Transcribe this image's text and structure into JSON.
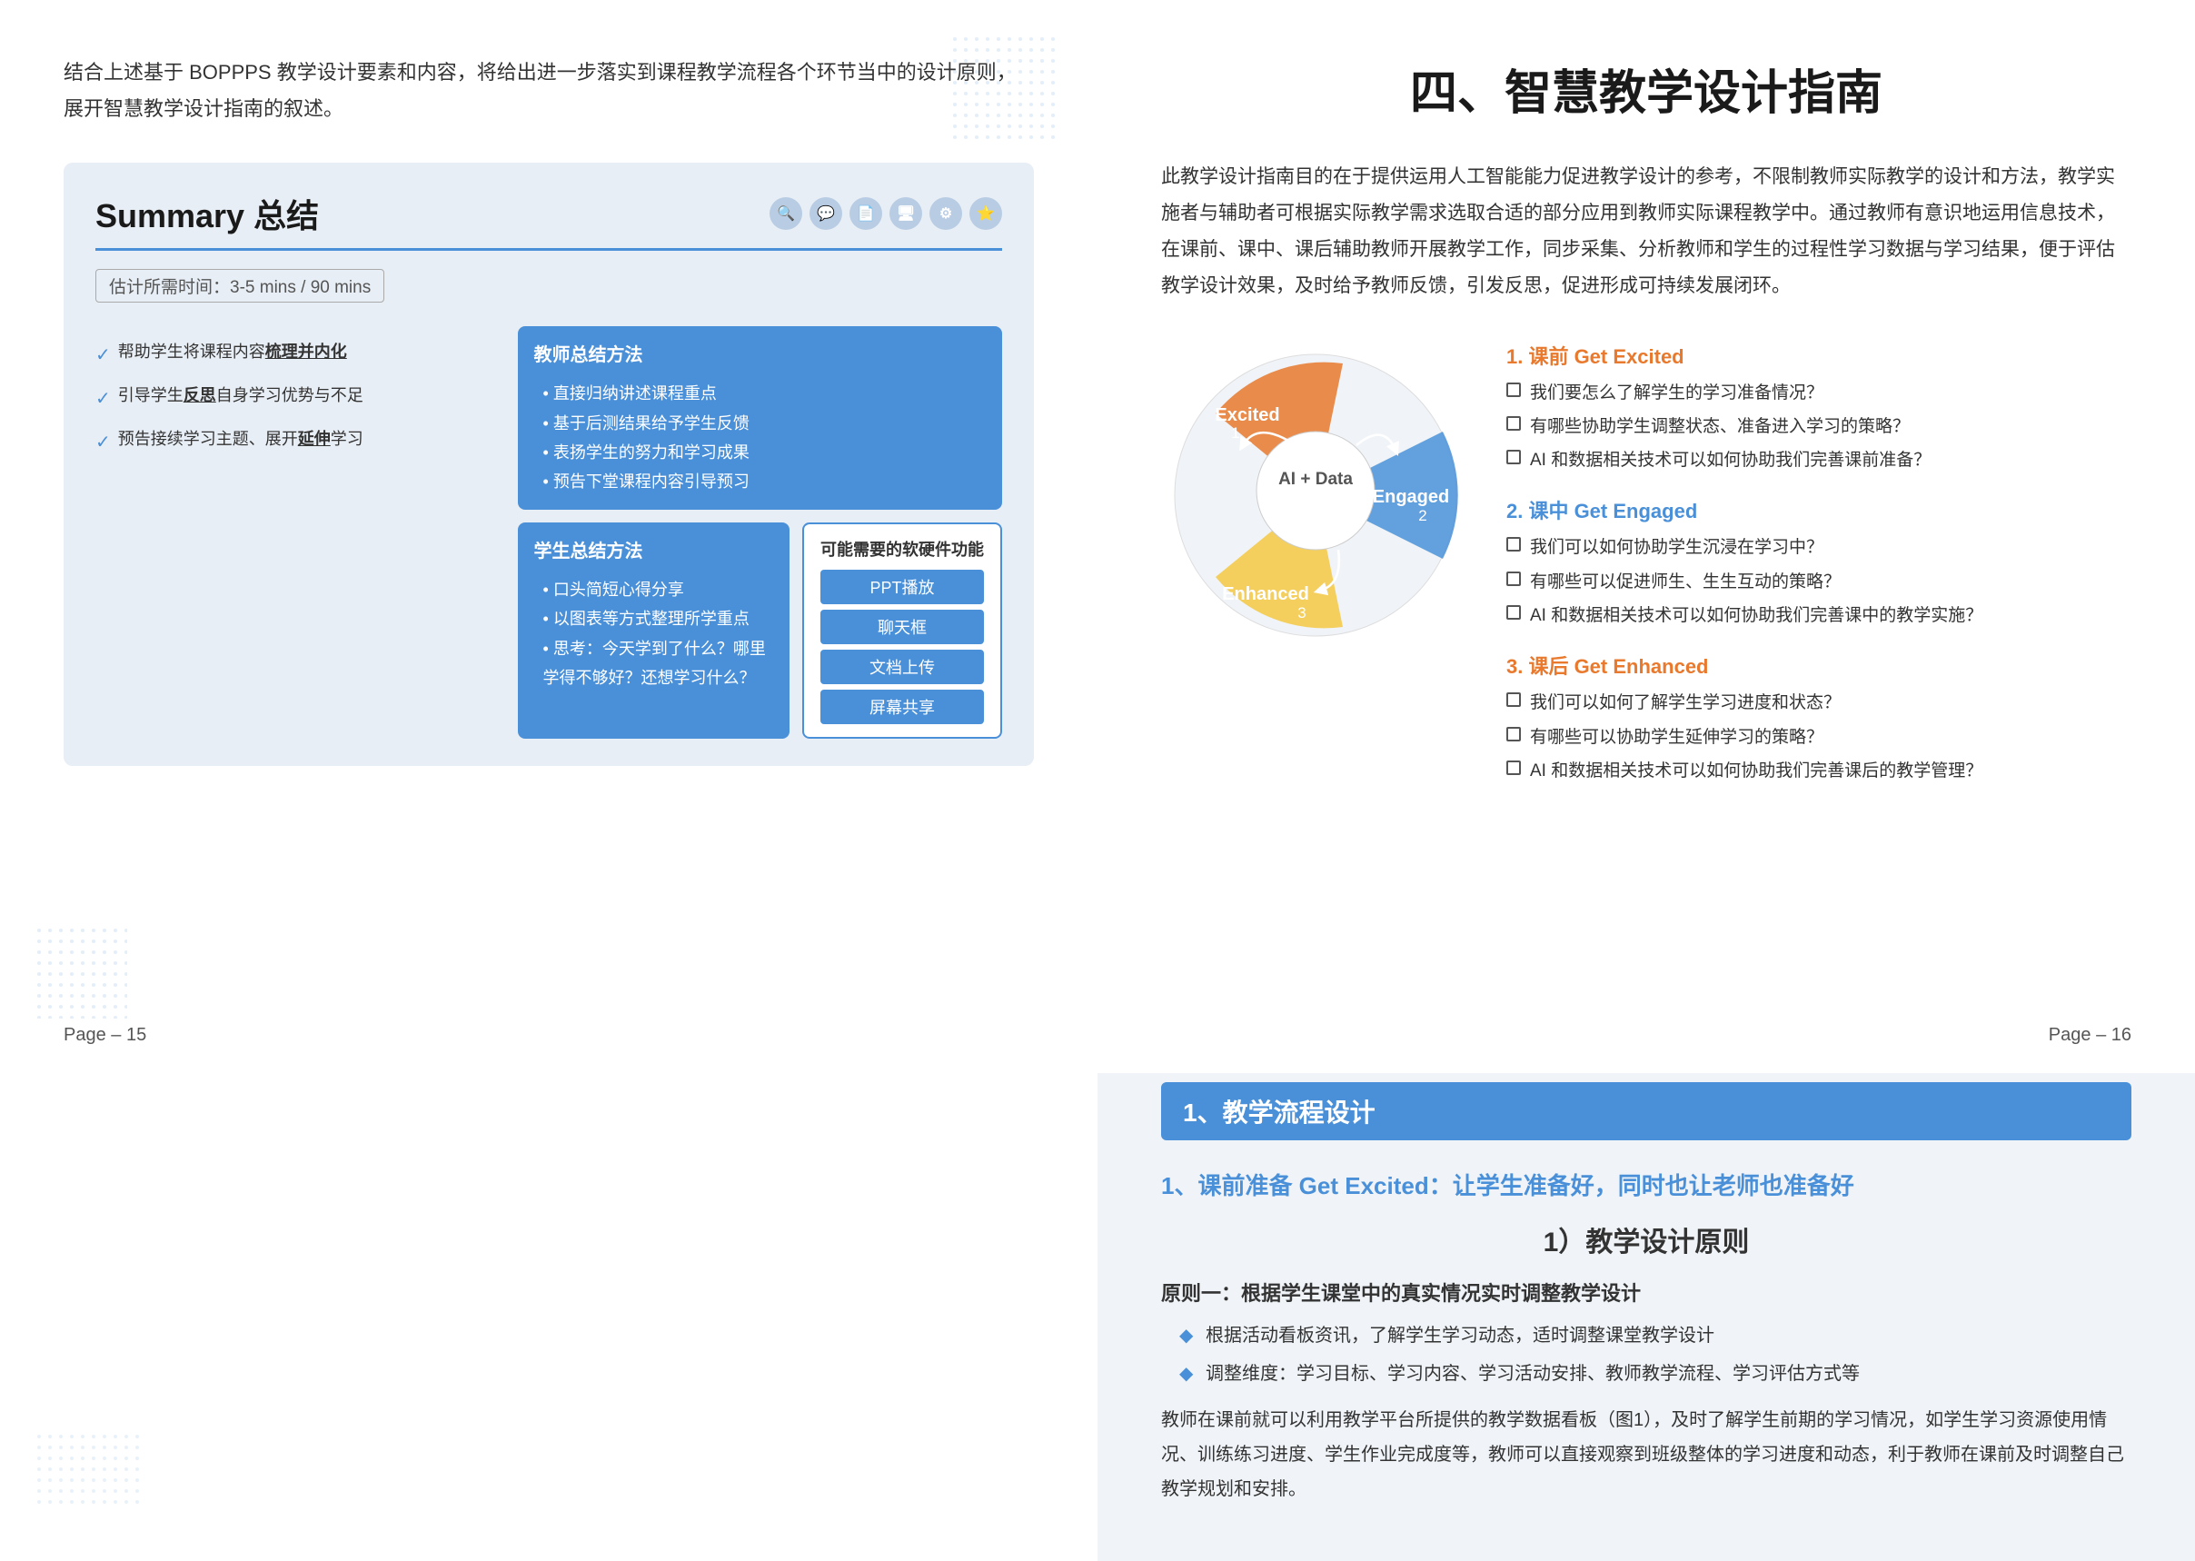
{
  "pageLeft": {
    "introText": "结合上述基于 BOPPPS 教学设计要素和内容，将给出进一步落实到课程教学流程各个环节当中的设计原则，展开智慧教学设计指南的叙述。",
    "summary": {
      "title": "Summary 总结",
      "timeLabel": "估计所需时间：3-5 mins / 90 mins",
      "teacherMethod": {
        "title": "教师总结方法",
        "items": [
          "直接归纳讲述课程重点",
          "基于后测结果给予学生反馈",
          "表扬学生的努力和学习成果",
          "预告下堂课程内容引导预习"
        ]
      },
      "software": {
        "title": "可能需要的软硬件功能",
        "items": [
          "PPT播放",
          "聊天框",
          "文档上传",
          "屏幕共享"
        ]
      },
      "studentMethod": {
        "title": "学生总结方法",
        "items": [
          "口头简短心得分享",
          "以图表等方式整理所学重点",
          "思考：今天学到了什么？哪里学得不够好？还想学习什么？"
        ]
      },
      "checklist": [
        "帮助学生将课程内容梳理并内化",
        "引导学生反思自身学习优势与不足",
        "预告接续学习主题、展开延伸学习"
      ]
    }
  },
  "pageRight": {
    "title": "四、智慧教学设计指南",
    "introText": "此教学设计指南目的在于提供运用人工智能能力促进教学设计的参考，不限制教师实际教学的设计和方法，教学实施者与辅助者可根据实际教学需求选取合适的部分应用到教师实际课程教学中。通过教师有意识地运用信息技术，在课前、课中、课后辅助教师开展教学工作，同步采集、分析教师和学生的过程性学习数据与学习结果，便于评估教学设计效果，及时给予教师反馈，引发反思，促进形成可持续发展闭环。",
    "diagram": {
      "labels": [
        "Excited",
        "Engaged",
        "Enhanced",
        "AI + Data"
      ],
      "colors": {
        "excited": "#e8792d",
        "engaged": "#4a90d9",
        "enhanced": "#f5c842",
        "aiData": "#888"
      }
    },
    "legend": {
      "section1": {
        "title": "1. 课前 Get Excited",
        "color": "orange",
        "items": [
          "我们要怎么了解学生的学习准备情况？",
          "有哪些协助学生调整状态、准备进入学习的策略？",
          "AI 和数据相关技术可以如何协助我们完善课前准备？"
        ]
      },
      "section2": {
        "title": "2. 课中 Get Engaged",
        "color": "blue",
        "items": [
          "我们可以如何协助学生沉浸在学习中？",
          "有哪些可以促进师生、生生互动的策略？",
          "AI 和数据相关技术可以如何协助我们完善课中的教学实施？"
        ]
      },
      "section3": {
        "title": "3. 课后 Get Enhanced",
        "color": "orange",
        "items": [
          "我们可以如何了解学生学习进度和状态？",
          "有哪些可以协助学生延伸学习的策略？",
          "AI 和数据相关技术可以如何协助我们完善课后的教学管理？"
        ]
      }
    }
  },
  "pageBottom": {
    "sectionHeader": "1、教学流程设计",
    "subsectionTitle": "1、课前准备 Get Excited：让学生准备好，同时也让老师也准备好",
    "centeredTitle": "1）教学设计原则",
    "principle1": {
      "title": "原则一：根据学生课堂中的真实情况实时调整教学设计",
      "points": [
        "根据活动看板资讯，了解学生学习动态，适时调整课堂教学设计",
        "调整维度：学习目标、学习内容、学习活动安排、教师教学流程、学习评估方式等"
      ],
      "bodyText": "教师在课前就可以利用教学平台所提供的教学数据看板（图1），及时了解学生前期的学习情况，如学生学习资源使用情况、训练练习进度、学生作业完成度等，教师可以直接观察到班级整体的学习进度和动态，利于教师在课前及时调整自己教学规划和安排。"
    }
  },
  "pageNumbers": {
    "left": "Page – 15",
    "right": "Page – 16"
  }
}
